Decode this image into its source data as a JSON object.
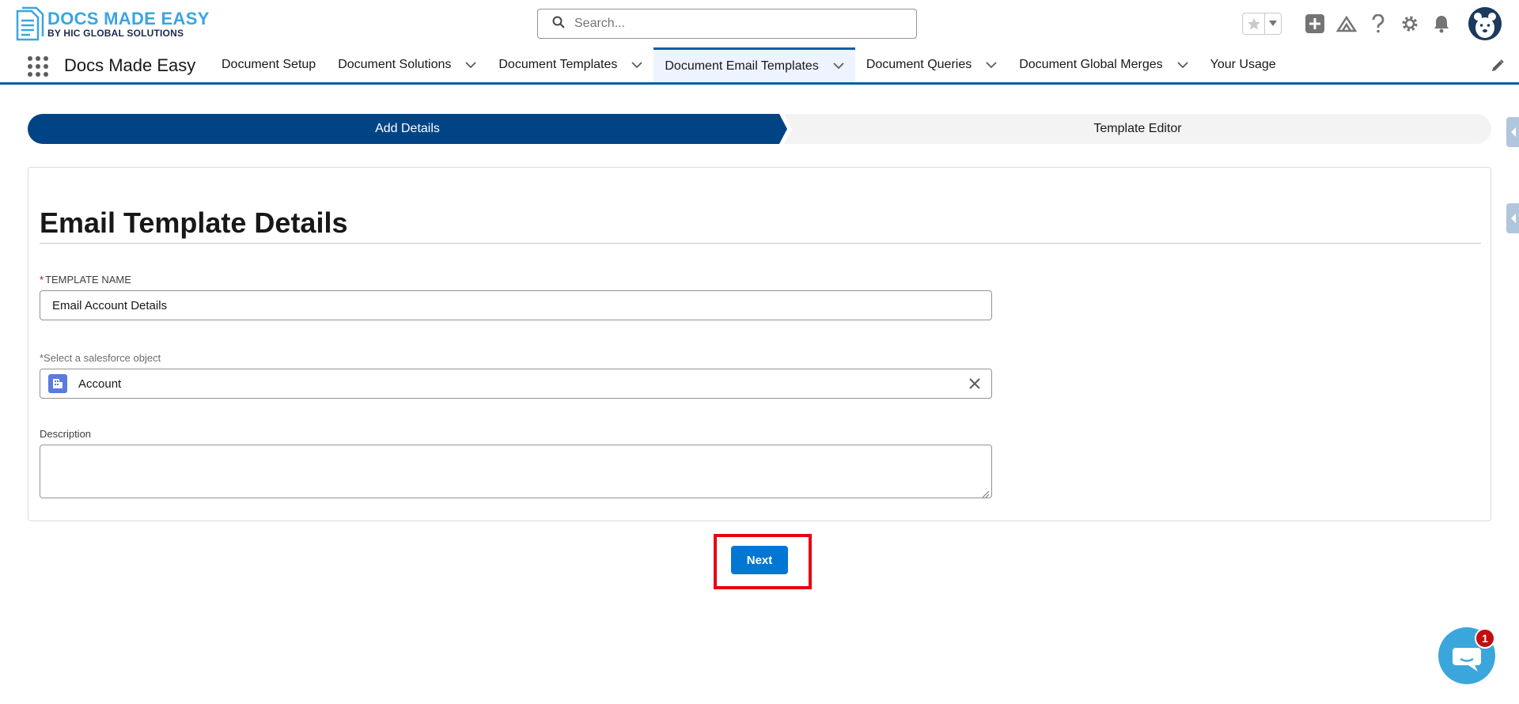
{
  "header": {
    "logo_title": "DOCS MADE EASY",
    "logo_subtitle": "BY HIC GLOBAL SOLUTIONS",
    "search_placeholder": "Search..."
  },
  "nav": {
    "app_name": "Docs Made Easy",
    "items": [
      {
        "label": "Document Setup",
        "has_menu": false,
        "active": false
      },
      {
        "label": "Document Solutions",
        "has_menu": true,
        "active": false
      },
      {
        "label": "Document Templates",
        "has_menu": true,
        "active": false
      },
      {
        "label": "Document Email Templates",
        "has_menu": true,
        "active": true
      },
      {
        "label": "Document Queries",
        "has_menu": true,
        "active": false
      },
      {
        "label": "Document Global Merges",
        "has_menu": true,
        "active": false
      },
      {
        "label": "Your Usage",
        "has_menu": false,
        "active": false
      }
    ]
  },
  "path": {
    "steps": [
      "Add Details",
      "Template Editor"
    ],
    "current_step": "Add Details"
  },
  "form": {
    "title": "Email Template Details",
    "template_name_label": "TEMPLATE NAME",
    "template_name_value": "Email Account Details",
    "object_label": "*Select a salesforce object",
    "object_value": "Account",
    "description_label": "Description",
    "description_value": ""
  },
  "actions": {
    "next_label": "Next"
  },
  "chat": {
    "badge_count": "1"
  },
  "colors": {
    "brand_blue": "#0176d3",
    "path_active": "#014486",
    "highlight_red": "#e8000b"
  }
}
